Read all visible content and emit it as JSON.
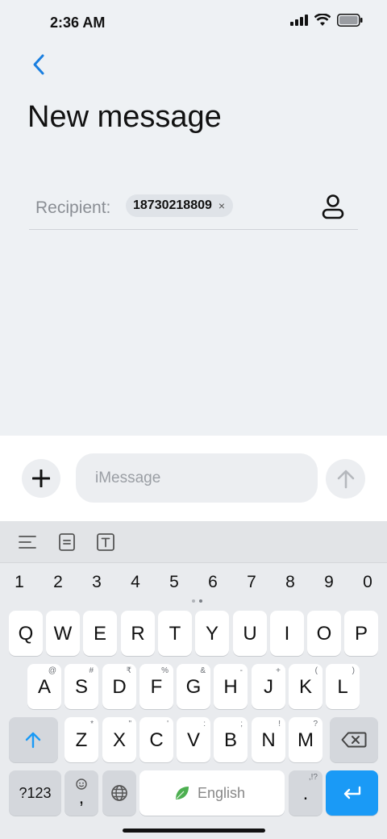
{
  "status": {
    "time": "2:36 AM"
  },
  "header": {
    "title": "New message"
  },
  "recipient": {
    "label": "Recipient:",
    "chip_value": "18730218809",
    "chip_remove": "×"
  },
  "compose": {
    "placeholder": "iMessage"
  },
  "keyboard": {
    "numbers": [
      "1",
      "2",
      "3",
      "4",
      "5",
      "6",
      "7",
      "8",
      "9",
      "0"
    ],
    "row1": [
      [
        "Q",
        ""
      ],
      [
        "W",
        ""
      ],
      [
        "E",
        ""
      ],
      [
        "R",
        ""
      ],
      [
        "T",
        ""
      ],
      [
        "Y",
        ""
      ],
      [
        "U",
        ""
      ],
      [
        "I",
        ""
      ],
      [
        "O",
        ""
      ],
      [
        "P",
        ""
      ]
    ],
    "row2": [
      [
        "A",
        "@"
      ],
      [
        "S",
        "#"
      ],
      [
        "D",
        "₹"
      ],
      [
        "F",
        "%"
      ],
      [
        "G",
        "&"
      ],
      [
        "H",
        "-"
      ],
      [
        "J",
        "+"
      ],
      [
        "K",
        "("
      ],
      [
        "L",
        ")"
      ]
    ],
    "row3": [
      [
        "Z",
        "*"
      ],
      [
        "X",
        "\""
      ],
      [
        "C",
        "'"
      ],
      [
        "V",
        ":"
      ],
      [
        "B",
        ";"
      ],
      [
        "N",
        "!"
      ],
      [
        "M",
        "?"
      ]
    ],
    "sym_label": "?123",
    "emoji_comma": ",",
    "space_label": "English",
    "period": ".",
    "period_sub": ",!?"
  },
  "colors": {
    "accent": "#1a9af6",
    "back_arrow": "#1a7fe0"
  }
}
